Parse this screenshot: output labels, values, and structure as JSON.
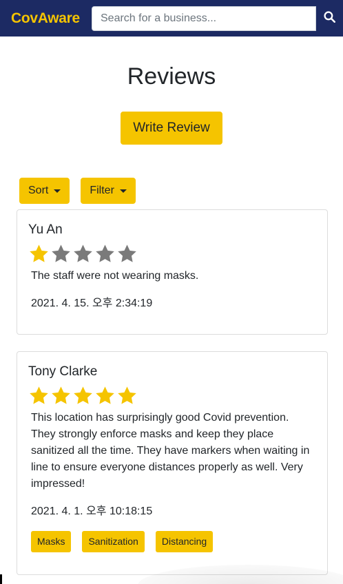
{
  "navbar": {
    "brand": "CovAware",
    "search_placeholder": "Search for a business...",
    "search_icon": "search-icon"
  },
  "page": {
    "title": "Reviews",
    "write_review_label": "Write Review",
    "sort_label": "Sort",
    "filter_label": "Filter"
  },
  "colors": {
    "navbar": "#1c2a63",
    "accent": "#f5c400",
    "star_filled": "#f5c400",
    "star_empty": "#7a7a7a"
  },
  "reviews": [
    {
      "name": "Yu An",
      "rating": 1,
      "max_rating": 5,
      "text": "The staff were not wearing masks.",
      "date": "2021. 4. 15. 오후 2:34:19",
      "tags": []
    },
    {
      "name": "Tony Clarke",
      "rating": 5,
      "max_rating": 5,
      "text": "This location has surprisingly good Covid prevention. They strongly enforce masks and keep they place sanitized all the time. They have markers when waiting in line to ensure everyone distances properly as well. Very impressed!",
      "date": "2021. 4. 1. 오후 10:18:15",
      "tags": [
        "Masks",
        "Sanitization",
        "Distancing"
      ]
    }
  ]
}
